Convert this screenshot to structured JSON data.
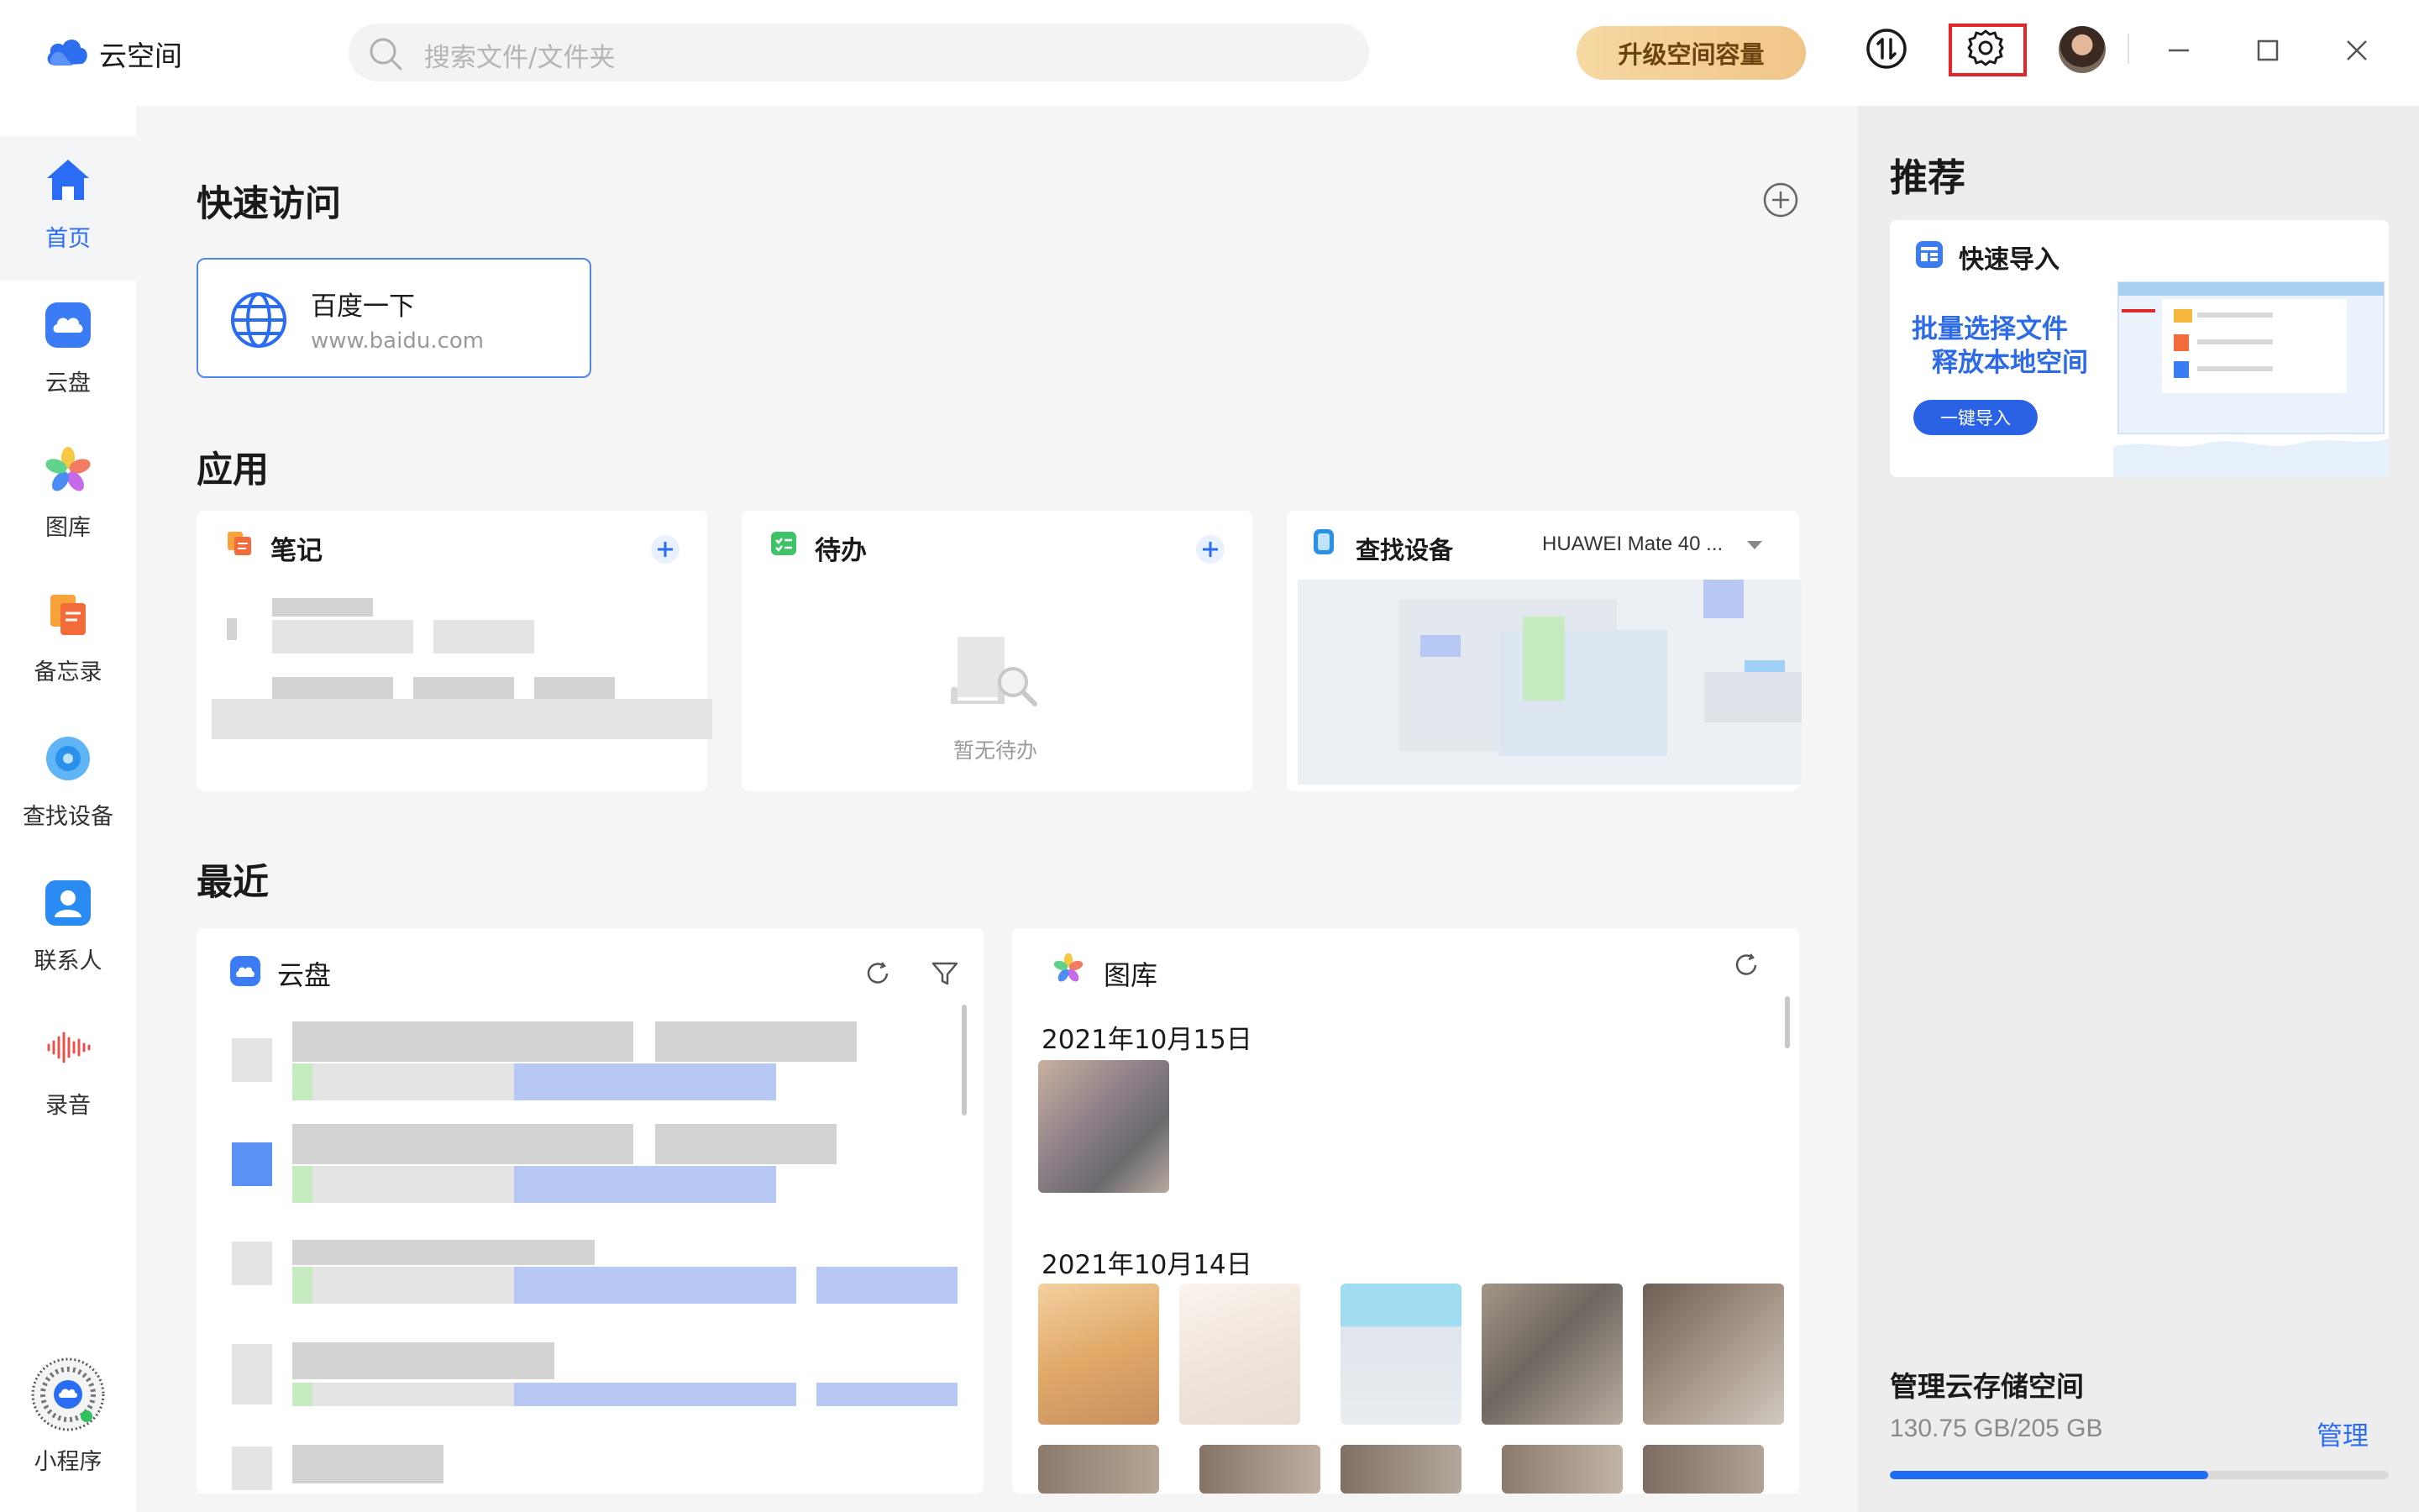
{
  "app": {
    "title": "云空间"
  },
  "search": {
    "placeholder": "搜索文件/文件夹"
  },
  "header": {
    "upgrade_label": "升级空间容量"
  },
  "nav": {
    "items": [
      {
        "label": "首页",
        "icon": "home-icon"
      },
      {
        "label": "云盘",
        "icon": "cloud-drive-icon"
      },
      {
        "label": "图库",
        "icon": "gallery-icon"
      },
      {
        "label": "备忘录",
        "icon": "memo-icon"
      },
      {
        "label": "查找设备",
        "icon": "find-device-icon"
      },
      {
        "label": "联系人",
        "icon": "contacts-icon"
      },
      {
        "label": "录音",
        "icon": "recorder-icon"
      }
    ],
    "mini_program": "小程序",
    "active": "首页"
  },
  "quick_access": {
    "title": "快速访问",
    "items": [
      {
        "title": "百度一下",
        "url": "www.baidu.com"
      }
    ]
  },
  "apps": {
    "title": "应用",
    "notes": {
      "label": "笔记"
    },
    "todo": {
      "label": "待办",
      "empty_text": "暂无待办"
    },
    "find_device": {
      "label": "查找设备",
      "device": "HUAWEI Mate 40 ..."
    }
  },
  "recent": {
    "title": "最近",
    "drive": {
      "label": "云盘"
    },
    "gallery": {
      "label": "图库",
      "dates": [
        "2021年10月15日",
        "2021年10月14日"
      ]
    }
  },
  "recommend": {
    "title": "推荐",
    "promo": {
      "heading": "快速导入",
      "line1": "批量选择文件",
      "line2": "释放本地空间",
      "button": "一键导入"
    }
  },
  "storage": {
    "title": "管理云存储空间",
    "used": "130.75 GB/205 GB",
    "used_fraction": 0.6378,
    "manage_label": "管理"
  },
  "colors": {
    "accent": "#2a6cf3",
    "upgrade_bg": "#f1c588",
    "highlight_box": "#e3252a"
  }
}
